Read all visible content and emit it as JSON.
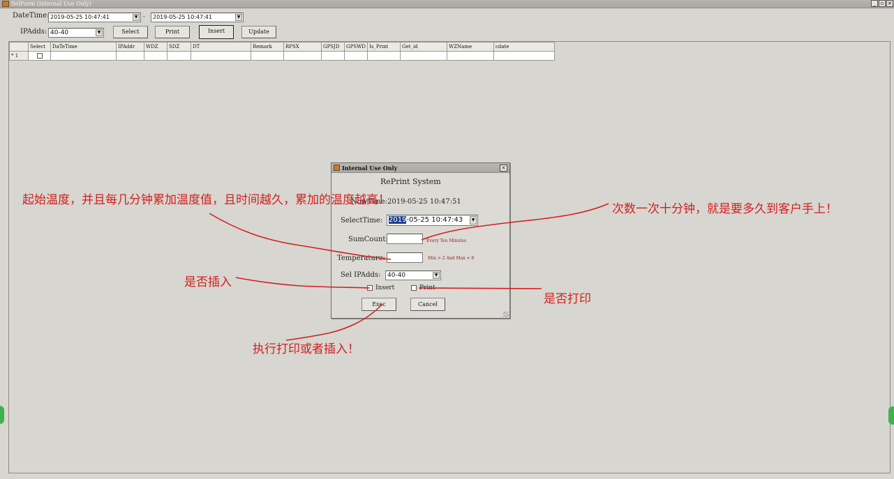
{
  "window": {
    "title": "SelForm (Internal Use Only)"
  },
  "filter": {
    "datetime_label": "DateTime:",
    "from_value": "2019-05-25 10:47:41",
    "separator": "-",
    "to_value": "2019-05-25 10:47:41",
    "ipadds_label": "IPAdds:",
    "ipadds_value": "40-40"
  },
  "toolbar": {
    "select": "Select",
    "print": "Print",
    "insert": "Insert",
    "update": "Update"
  },
  "grid": {
    "columns": [
      "Select",
      "DaTeTime",
      "IPAddr",
      "WDZ",
      "SDZ",
      "DT",
      "Remark",
      "RPSX",
      "GPSJD",
      "GPSWD",
      "Is_Print",
      "Get_id",
      "WZName",
      "cdate"
    ],
    "new_row_marker": "*",
    "row_number": "1"
  },
  "dialog": {
    "title": "Internal Use Only",
    "heading": "RePrint System",
    "now_label": "NowTime:",
    "now_value": "2019-05-25 10:47:51",
    "selecttime_label": "SelectTime:",
    "selecttime_highlight": "2019",
    "selecttime_rest": "-05-25 10:47:43",
    "sumcount_label": "SumCount:",
    "sumcount_value": "",
    "sumcount_hint": "Every Ten Minutes",
    "temperature_label": "Temperature:",
    "temperature_value": "",
    "temperature_hint": "Min > 2 And Max < 8",
    "selip_label": "Sel IPAdds:",
    "selip_value": "40-40",
    "insert_label": "Insert",
    "print_label": "Print",
    "exec_label": "Exec",
    "cancel_label": "Cancel"
  },
  "annotations": {
    "temperature_note": "起始温度，并且每几分钟累加温度值，且时间越久，累加的温度越高！",
    "count_note": "次数一次十分钟，就是要多久到客户手上！",
    "insert_note": "是否插入",
    "print_note": "是否打印",
    "exec_note": "执行打印或者插入！",
    "color": "#d12020"
  }
}
